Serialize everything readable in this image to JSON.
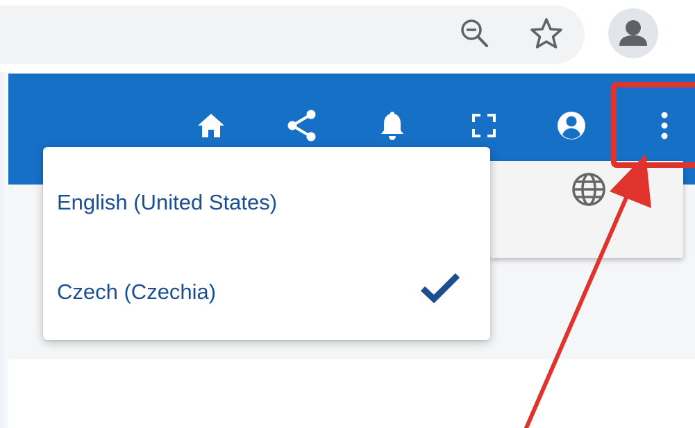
{
  "browser": {
    "zoom_icon": "zoom-out-icon",
    "bookmark_icon": "star-icon",
    "profile_icon": "person-icon"
  },
  "toolbar": {
    "color": "#1670c6",
    "icons": [
      "home-icon",
      "share-icon",
      "bell-icon",
      "fullscreen-icon",
      "account-icon",
      "more-vertical-icon"
    ]
  },
  "language_menu": {
    "items": [
      {
        "label": "English (United States)",
        "selected": false
      },
      {
        "label": "Czech (Czechia)",
        "selected": true
      }
    ],
    "text_color": "#1b4f91",
    "check_color": "#1b4f91"
  },
  "small_menu": {
    "icon": "globe-icon"
  },
  "annotation": {
    "color": "#e0332b"
  }
}
